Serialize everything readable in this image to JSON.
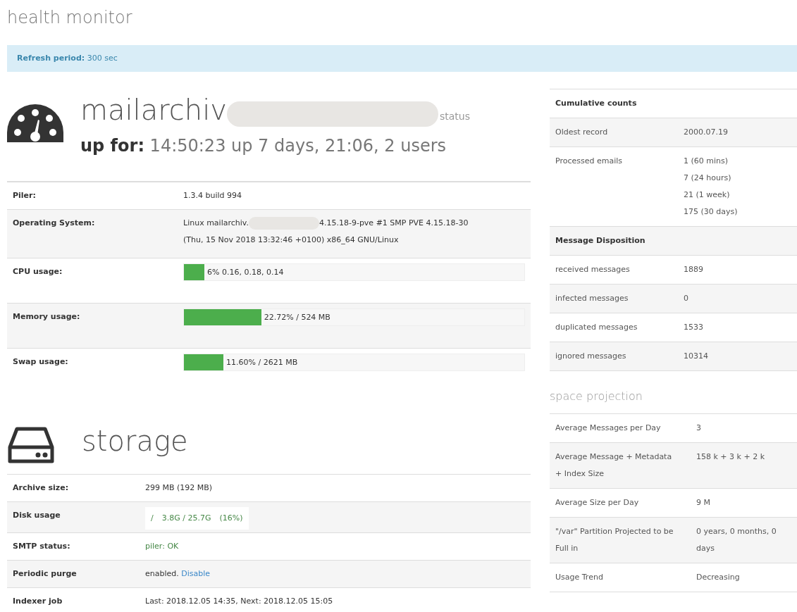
{
  "page_title": "health monitor",
  "refresh": {
    "label": "Refresh period:",
    "value": "300 sec"
  },
  "host": {
    "name": "mailarchiv",
    "redacted": true,
    "status": "status",
    "uptime_label": "up for:",
    "uptime": "14:50:23 up 7 days, 21:06, 2 users"
  },
  "system_rows": [
    {
      "kind": "text",
      "label": "Piler:",
      "value": "1.3.4 build 994"
    },
    {
      "kind": "redacted",
      "label": "Operating System:",
      "value": "Linux mailarchiv.",
      "value_after": "4.15.18-9-pve #1 SMP PVE 4.15.18-30",
      "value_line2": "(Thu, 15 Nov 2018 13:32:46 +0100) x86_64 GNU/Linux"
    },
    {
      "kind": "bar",
      "label": "CPU usage:",
      "level": 0.06,
      "value": "6% 0.16, 0.18, 0.14"
    },
    {
      "kind": "bar",
      "label": "Memory usage:",
      "level": 0.2272,
      "value": "22.72% / 524 MB"
    },
    {
      "kind": "bar",
      "label": "Swap usage:",
      "level": 0.116,
      "value": "11.60% / 2621 MB"
    }
  ],
  "storage": {
    "title": "storage",
    "rows": [
      {
        "kind": "text",
        "label": "Archive size:",
        "value": "299 MB (192 MB)"
      },
      {
        "kind": "disk",
        "label": "Disk usage",
        "mount": "/",
        "value": "3.8G / 25.7G",
        "percent": "(16%)"
      },
      {
        "kind": "ok",
        "label": "SMTP status:",
        "value": "piler: OK"
      },
      {
        "kind": "link",
        "label": "Periodic purge",
        "value": "enabled.",
        "link": "Disable"
      },
      {
        "kind": "text",
        "label": "Indexer job",
        "value": "Last: 2018.12.05 14:35, Next: 2018.12.05 15:05"
      }
    ]
  },
  "counts": [
    {
      "kind": "header",
      "label": "Cumulative counts"
    },
    {
      "kind": "row",
      "label": "Oldest record",
      "values": [
        "2000.07.19"
      ]
    },
    {
      "kind": "row",
      "label": "Processed emails",
      "values": [
        "1 (60 mins)",
        "7 (24 hours)",
        "21 (1 week)",
        "175 (30 days)"
      ]
    },
    {
      "kind": "header",
      "label": "Message Disposition"
    },
    {
      "kind": "row",
      "label": "received messages",
      "values": [
        "1889"
      ]
    },
    {
      "kind": "row",
      "label": "infected messages",
      "values": [
        "0"
      ]
    },
    {
      "kind": "row",
      "label": "duplicated messages",
      "values": [
        "1533"
      ]
    },
    {
      "kind": "row",
      "label": "ignored messages",
      "values": [
        "10314"
      ]
    }
  ],
  "projection": {
    "title": "space projection",
    "rows": [
      {
        "label": "Average Messages per Day",
        "value": "3"
      },
      {
        "label": "Average Message + Metadata + Index Size",
        "value": "158 k + 3 k + 2 k"
      },
      {
        "label": "Average Size per Day",
        "value": "9 M"
      },
      {
        "label": "\"/var\" Partition Projected to be Full in",
        "value": "0 years, 0 months, 0 days"
      },
      {
        "label": "Usage Trend",
        "value": "Decreasing"
      }
    ]
  }
}
